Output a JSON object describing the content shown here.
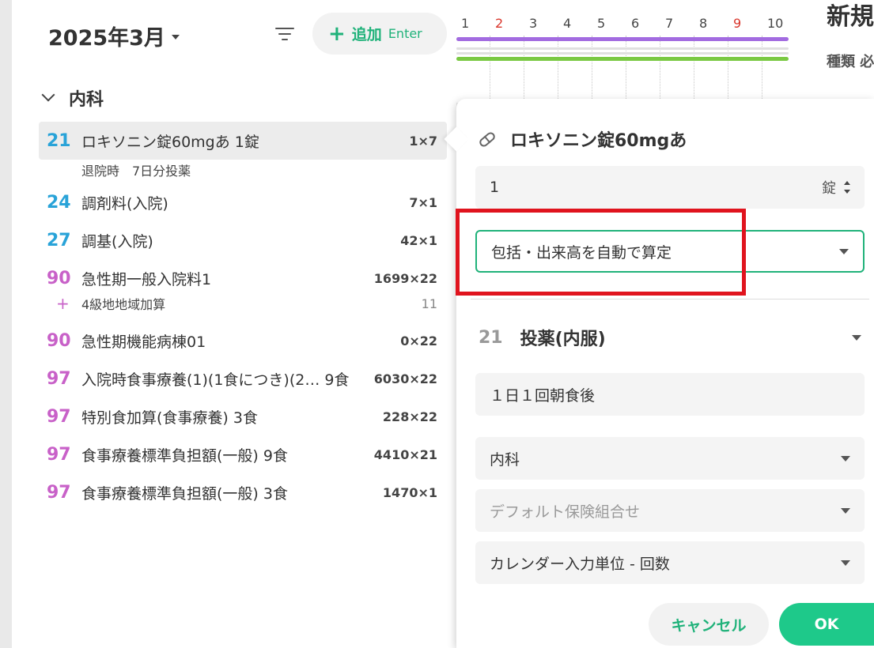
{
  "header": {
    "month": "2025年3月",
    "add_label": "追加",
    "add_key": "Enter"
  },
  "calendar": {
    "days": [
      {
        "d": "1",
        "red": false
      },
      {
        "d": "2",
        "red": true
      },
      {
        "d": "3",
        "red": false
      },
      {
        "d": "4",
        "red": false
      },
      {
        "d": "5",
        "red": false
      },
      {
        "d": "6",
        "red": false
      },
      {
        "d": "7",
        "red": false
      },
      {
        "d": "8",
        "red": false
      },
      {
        "d": "9",
        "red": true
      },
      {
        "d": "10",
        "red": false
      }
    ],
    "bar_colors": [
      "#a26be0",
      "#e0e0e0",
      "#e0e0e0",
      "#7ac943"
    ]
  },
  "department": "内科",
  "orders": [
    {
      "code": "21",
      "color": "#29a3d8",
      "title": "ロキソニン錠60mgあ 1錠",
      "qty": "1×7",
      "sub": "退院時　7日分投薬"
    },
    {
      "code": "24",
      "color": "#29a3d8",
      "title": "調剤料(入院)",
      "qty": "7×1"
    },
    {
      "code": "27",
      "color": "#29a3d8",
      "title": "調基(入院)",
      "qty": "42×1"
    },
    {
      "code": "90",
      "color": "#c861c8",
      "title": "急性期一般入院料1",
      "qty": "1699×22",
      "addon": {
        "label": "4級地地域加算",
        "value": "11"
      }
    },
    {
      "code": "90",
      "color": "#c861c8",
      "title": "急性期機能病棟01",
      "qty": "0×22"
    },
    {
      "code": "97",
      "color": "#c861c8",
      "title": "入院時食事療養(1)(1食につき)(2… 9食",
      "qty": "6030×22"
    },
    {
      "code": "97",
      "color": "#c861c8",
      "title": "特別食加算(食事療養) 3食",
      "qty": "228×22"
    },
    {
      "code": "97",
      "color": "#c861c8",
      "title": "食事療養標準負担額(一般) 9食",
      "qty": "4410×21"
    },
    {
      "code": "97",
      "color": "#c861c8",
      "title": "食事療養標準負担額(一般) 3食",
      "qty": "1470×1"
    }
  ],
  "right_panel": {
    "title": "新規",
    "label": "種類 必"
  },
  "popover": {
    "drug_name": "ロキソニン錠60mgあ",
    "quantity": "1",
    "unit": "錠",
    "billing_mode": "包括・出来高を自動で算定",
    "section_code": "21",
    "section_title": "投薬(内服)",
    "usage": "１日１回朝食後",
    "department": "内科",
    "insurance_placeholder": "デフォルト保険組合せ",
    "calendar_unit": "カレンダー入力単位 - 回数",
    "cancel_label": "キャンセル",
    "ok_label": "OK"
  }
}
